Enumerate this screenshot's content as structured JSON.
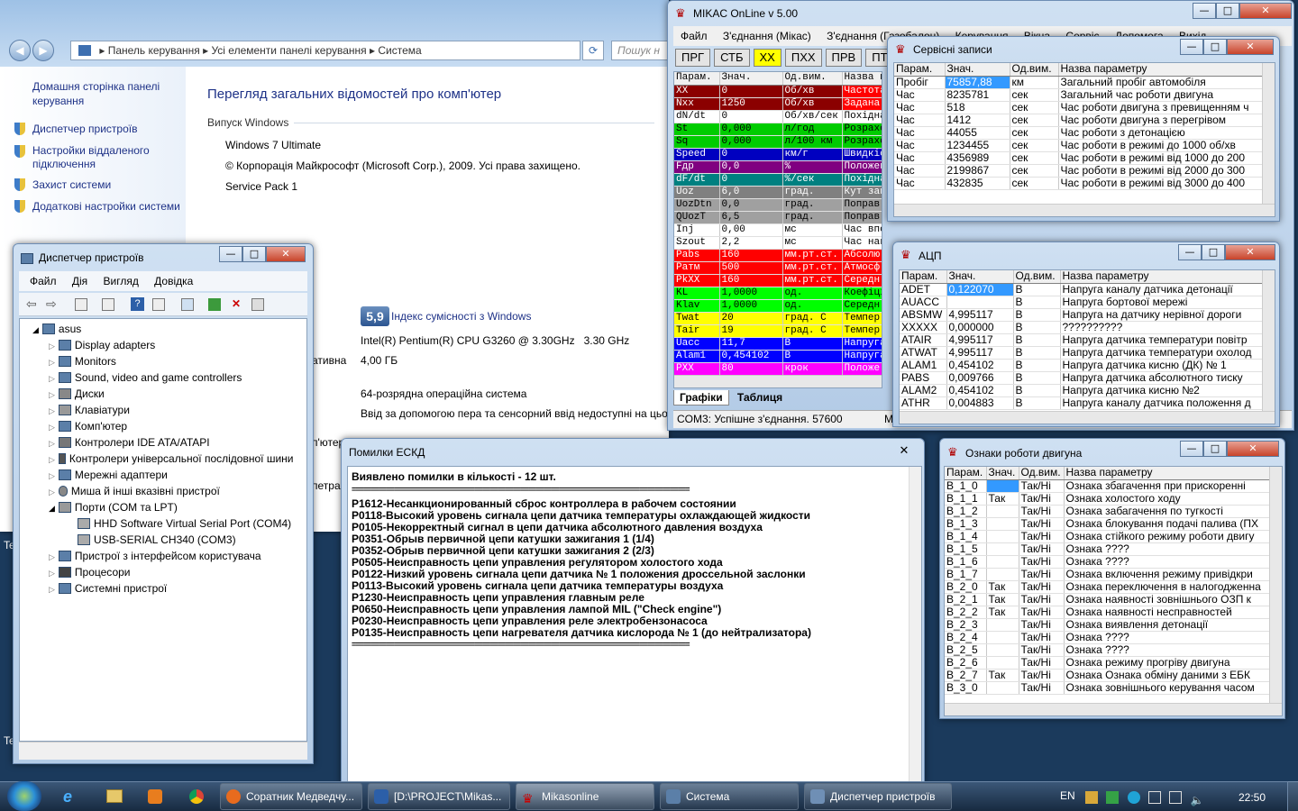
{
  "desktop": {
    "stray_text_1": "Te",
    "stray_text_2": "Te"
  },
  "explorer": {
    "breadcrumb": [
      "Панель керування",
      "Усі елементи панелі керування",
      "Система"
    ],
    "search_placeholder": "Пошук н",
    "side_links": [
      "Домашня сторінка панелі керування",
      "Диспетчер пристроїв",
      "Настройки віддаленого підключення",
      "Захист системи",
      "Додаткові настройки системи"
    ],
    "heading": "Перегляд загальних відомостей про комп'ютер",
    "edition_label": "Випуск Windows",
    "edition": "Windows 7 Ultimate",
    "copyright": "© Корпорація Майкрософт (Microsoft Corp.), 2009. Усі права захищено.",
    "service_pack": "Service Pack 1",
    "rating_value": "5,9",
    "rating_link": "Індекс сумісності з Windows",
    "cpu": "Intel(R) Pentium(R) CPU G3260 @ 3.30GHz   3.30 GHz",
    "ram_label_part": "ативна",
    "ram": "4,00 ГБ",
    "os_type": "64-розрядна операційна система",
    "pen": "Ввід за допомогою пера та сенсорний ввід недоступні на цьо",
    "frag1": "п'ютер",
    "frag2": "петра"
  },
  "devmgr": {
    "title": "Диспетчер пристроїв",
    "menu": [
      "Файл",
      "Дія",
      "Вигляд",
      "Довідка"
    ],
    "root": "asus",
    "items": [
      "Display adapters",
      "Monitors",
      "Sound, video and game controllers",
      "Диски",
      "Клавіатури",
      "Комп'ютер",
      "Контролери IDE ATA/ATAPI",
      "Контролери універсальної послідовної шини",
      "Мережні адаптери",
      "Миша й інші вказівні пристрої",
      "Порти (COM та LPT)"
    ],
    "ports": [
      "HHD Software Virtual Serial Port (COM4)",
      "USB-SERIAL CH340 (COM3)"
    ],
    "items2": [
      "Пристрої з інтерфейсом користувача",
      "Процесори",
      "Системні пристрої"
    ]
  },
  "mikas": {
    "title": "MIKAC OnLine v 5.00",
    "menu": [
      "Файл",
      "З'єднання (Мікас)",
      "З'єднання (Газобалон)",
      "Керування",
      "Вікна",
      "Сервіс",
      "Допомога",
      "Вихід"
    ],
    "buttons": [
      "ПРГ",
      "СТБ",
      "XX",
      "ПХХ",
      "ПРВ",
      "ПТН"
    ],
    "headers": [
      "Парам.",
      "Знач.",
      "Од.вим.",
      "Назва п"
    ],
    "rows": [
      [
        "XX",
        "0",
        "Об/хв",
        "Частота",
        "#8b0000",
        "#ff0000"
      ],
      [
        "Nxx",
        "1250",
        "Об/хв",
        "Задана",
        "#8b0000",
        "#ff0000"
      ],
      [
        "dN/dt",
        "0",
        "Об/хв/сек",
        "Похідна",
        "#ffffff",
        "#ffffff"
      ],
      [
        "St",
        "0,000",
        "л/год",
        "Розрахо",
        "#00cc00",
        "#00cc00"
      ],
      [
        "Sq",
        "0,000",
        "л/100 км",
        "Розрахо",
        "#00cc00",
        "#00cc00"
      ],
      [
        "Speed",
        "0",
        "км/г",
        "Швидкіс",
        "#0000c0",
        "#0000c0"
      ],
      [
        "Fдр",
        "0,0",
        "%",
        "Положен",
        "#800080",
        "#800080"
      ],
      [
        "dF/dt",
        "0",
        "%/сек",
        "Похідна",
        "#008080",
        "#008080"
      ],
      [
        "Uoz",
        "6,0",
        "град.",
        "Кут зап",
        "#808080",
        "#808080"
      ],
      [
        "UozDtn",
        "0,0",
        "град.",
        "Поправ",
        "#a0a0a0",
        "#a0a0a0"
      ],
      [
        "QUozT",
        "6,5",
        "град.",
        "Поправ",
        "#a0a0a0",
        "#a0a0a0"
      ],
      [
        "Inj",
        "0,00",
        "мс",
        "Час впо",
        "#ffffff",
        "#ffffff"
      ],
      [
        "Szout",
        "2,2",
        "мс",
        "Час нак",
        "#ffffff",
        "#ffffff"
      ],
      [
        "Pabs",
        "160",
        "мм.рт.ст.",
        "Абсолю",
        "#ff0000",
        "#ff0000"
      ],
      [
        "Ратм",
        "500",
        "мм.рт.ст.",
        "Атмосф",
        "#ff0000",
        "#ff0000"
      ],
      [
        "PkXX",
        "160",
        "мм.рт.ст.",
        "Середн",
        "#ff0000",
        "#ff0000"
      ],
      [
        "KL",
        "1,0000",
        "од.",
        "Коефіці",
        "#00ff00",
        "#00ff00"
      ],
      [
        "Klav",
        "1,0000",
        "од.",
        "Середн",
        "#00ff00",
        "#00ff00"
      ],
      [
        "Twat",
        "20",
        "град. С",
        "Темпер",
        "#ffff00",
        "#ffff00"
      ],
      [
        "Tair",
        "19",
        "град. С",
        "Темпер",
        "#ffff00",
        "#ffff00"
      ],
      [
        "Uacc",
        "11,7",
        "В",
        "Напруга",
        "#0000ff",
        "#0000ff"
      ],
      [
        "Alam1",
        "0,454102",
        "В",
        "Напруга",
        "#0000ff",
        "#0000ff"
      ],
      [
        "PXX",
        "80",
        "крок",
        "Положе",
        "#ff00ff",
        "#ff00ff"
      ]
    ],
    "tabs": [
      "Графіки",
      "Таблиця"
    ],
    "status": "COM3: Успішне з'єднання. 57600",
    "status2": "М"
  },
  "service": {
    "title": "Сервісні записи",
    "headers": [
      "Парам.",
      "Знач.",
      "Од.вим.",
      "Назва параметру"
    ],
    "rows": [
      [
        "Пробіг",
        "75857,88",
        "км",
        "Загальний пробіг автомобіля"
      ],
      [
        "Час",
        "8235781",
        "сек",
        "Загальний час роботи двигуна"
      ],
      [
        "Час",
        "518",
        "сек",
        "Час роботи двигуна з превищенням ч"
      ],
      [
        "Час",
        "1412",
        "сек",
        "Час роботи двигуна з перегрівом"
      ],
      [
        "Час",
        "44055",
        "сек",
        "Час роботи з детонацією"
      ],
      [
        "Час",
        "1234455",
        "сек",
        "Час роботи в режимі до 1000 об/хв"
      ],
      [
        "Час",
        "4356989",
        "сек",
        "Час роботи в режимі від 1000 до 200"
      ],
      [
        "Час",
        "2199867",
        "сек",
        "Час роботи в режимі від 2000 до 300"
      ],
      [
        "Час",
        "432835",
        "сек",
        "Час роботи в режимі від 3000 до 400"
      ]
    ]
  },
  "adc": {
    "title": "АЦП",
    "headers": [
      "Парам.",
      "Знач.",
      "Од.вим.",
      "Назва параметру"
    ],
    "rows": [
      [
        "ADET",
        "0,122070",
        "В",
        "Напруга каналу датчика детонації"
      ],
      [
        "AUACC",
        "",
        "В",
        "Напруга бортової мережі"
      ],
      [
        "ABSMW",
        "4,995117",
        "В",
        "Напруга на датчику нерівної дороги"
      ],
      [
        "XXXXX",
        "0,000000",
        "В",
        "??????????"
      ],
      [
        "ATAIR",
        "4,995117",
        "В",
        "Напруга датчика температури повітр"
      ],
      [
        "ATWAT",
        "4,995117",
        "В",
        "Напруга датчика температури охолод"
      ],
      [
        "ALAM1",
        "0,454102",
        "В",
        "Напруга датчика кисню (ДК) № 1"
      ],
      [
        "PABS",
        "0,009766",
        "В",
        "Напруга датчика абсолютного тиску"
      ],
      [
        "ALAM2",
        "0,454102",
        "В",
        "Напруга датчика кисню №2"
      ],
      [
        "ATHR",
        "0,004883",
        "В",
        "Напруга каналу датчика положення д"
      ]
    ]
  },
  "errors": {
    "title": "Помилки ЕСКД",
    "header": "Виявлено помилки в кількості - 12 шт.",
    "separator": "========================================================================================",
    "lines": [
      "P1612-Несанкционированный сброс контроллера в рабочем состоянии",
      "P0118-Высокий уровень сигнала цепи датчика температуры охлаждающей жидкости",
      "P0105-Некорректный сигнал в цепи датчика абсолютного давления воздуха",
      "P0351-Обрыв первичной цепи катушки зажигания 1 (1/4)",
      "P0352-Обрыв первичной цепи катушки зажигания 2 (2/3)",
      "P0505-Неисправность цепи управления регулятором холостого хода",
      "P0122-Низкий уровень сигнала цепи датчика № 1 положения дроссельной заслонки",
      "P0113-Высокий уровень сигнала цепи датчика температуры воздуха",
      "P1230-Неисправность цепи управления главным реле",
      "P0650-Неисправность цепи управления лампой MIL (\"Check engine\")",
      "P0230-Неисправность цепи управления реле электробензонасоса",
      "P0135-Неисправность цепи нагревателя датчика кислорода № 1 (до нейтрализатора)"
    ]
  },
  "engine": {
    "title": "Ознаки роботи двигуна",
    "headers": [
      "Парам.",
      "Знач.",
      "Од.вим.",
      "Назва параметру"
    ],
    "rows": [
      [
        "B_1_0",
        "",
        "Так/Ні",
        "Ознака збагачення при прискоренні"
      ],
      [
        "B_1_1",
        "Так",
        "Так/Ні",
        "Ознака холостого ходу"
      ],
      [
        "B_1_2",
        "",
        "Так/Ні",
        "Ознака забагачення по тугкості"
      ],
      [
        "B_1_3",
        "",
        "Так/Ні",
        "Ознака блокування подачі палива (ПХ"
      ],
      [
        "B_1_4",
        "",
        "Так/Ні",
        "Ознака стійкого режиму роботи двигу"
      ],
      [
        "B_1_5",
        "",
        "Так/Ні",
        "Ознака ????"
      ],
      [
        "B_1_6",
        "",
        "Так/Ні",
        "Ознака ????"
      ],
      [
        "B_1_7",
        "",
        "Так/Ні",
        "Ознака включення режиму привідкри"
      ],
      [
        "B_2_0",
        "Так",
        "Так/Ні",
        "Ознака переключення в налогодженна"
      ],
      [
        "B_2_1",
        "Так",
        "Так/Ні",
        "Ознака наявності зовнішнього ОЗП к"
      ],
      [
        "B_2_2",
        "Так",
        "Так/Ні",
        "Ознака наявності несправностей"
      ],
      [
        "B_2_3",
        "",
        "Так/Ні",
        "Ознака виявлення детонації"
      ],
      [
        "B_2_4",
        "",
        "Так/Ні",
        "Ознака ????"
      ],
      [
        "B_2_5",
        "",
        "Так/Ні",
        "Ознака ????"
      ],
      [
        "B_2_6",
        "",
        "Так/Ні",
        "Ознака режиму прогріву двигуна"
      ],
      [
        "B_2_7",
        "Так",
        "Так/Ні",
        "Ознака Ознака обміну даними з ЕБК"
      ],
      [
        "B_3_0",
        "",
        "Так/Ні",
        "Ознака зовнішнього керування часом"
      ]
    ]
  },
  "taskbar": {
    "items": [
      "Соратник Медведчу...",
      "[D:\\PROJECT\\Mikas...",
      "Mikasonline",
      "Система",
      "Диспетчер пристроїв"
    ],
    "lang": "EN",
    "time": "22:50"
  }
}
